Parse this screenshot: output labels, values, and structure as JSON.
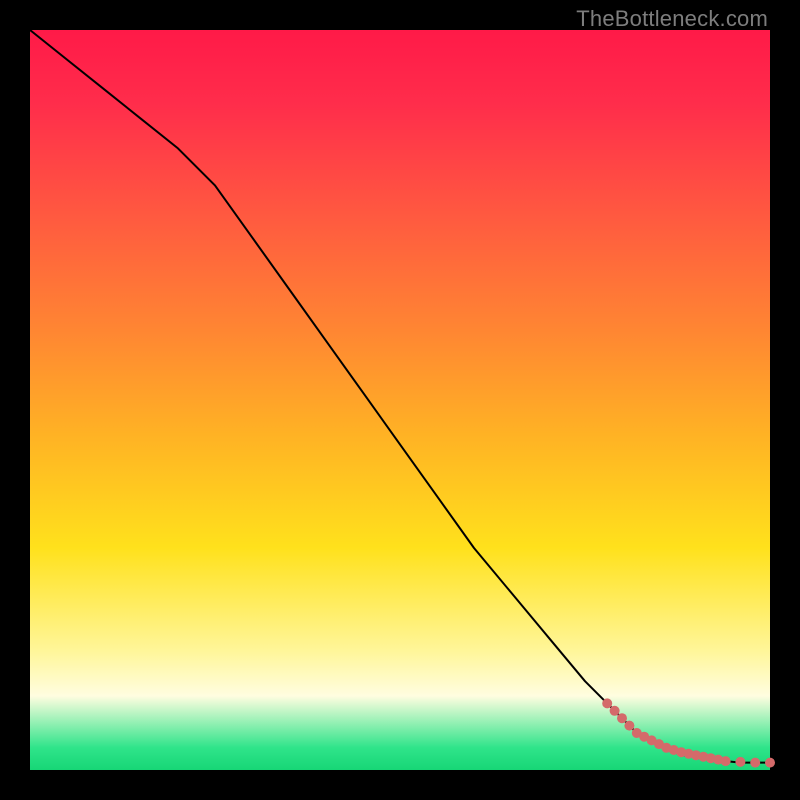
{
  "watermark": "TheBottleneck.com",
  "chart_data": {
    "type": "line",
    "title": "",
    "xlabel": "",
    "ylabel": "",
    "xlim": [
      0,
      100
    ],
    "ylim": [
      0,
      100
    ],
    "grid": false,
    "legend": false,
    "background_gradient": {
      "direction": "vertical",
      "stops": [
        {
          "pos": 0.0,
          "color": "#ff1a48"
        },
        {
          "pos": 0.25,
          "color": "#ff5940"
        },
        {
          "pos": 0.55,
          "color": "#ffb324"
        },
        {
          "pos": 0.8,
          "color": "#fff69a"
        },
        {
          "pos": 0.97,
          "color": "#2fe48a"
        },
        {
          "pos": 1.0,
          "color": "#17d676"
        }
      ]
    },
    "series": [
      {
        "name": "curve",
        "color": "#000000",
        "stroke_width": 2,
        "x": [
          0,
          5,
          10,
          15,
          20,
          25,
          30,
          35,
          40,
          45,
          50,
          55,
          60,
          65,
          70,
          75,
          80,
          82,
          84,
          86,
          88,
          90,
          92,
          94,
          96,
          98,
          100
        ],
        "y": [
          100,
          96,
          92,
          88,
          84,
          79,
          72,
          65,
          58,
          51,
          44,
          37,
          30,
          24,
          18,
          12,
          7,
          5,
          4,
          3,
          2,
          2,
          1.5,
          1.2,
          1.0,
          1.0,
          1.0
        ]
      },
      {
        "name": "points",
        "color": "#d46a6a",
        "marker": "circle",
        "marker_radius": 5,
        "x": [
          78,
          79,
          80,
          81,
          82,
          83,
          84,
          85,
          86,
          87,
          88,
          89,
          90,
          91,
          92,
          93,
          94,
          96,
          98,
          100
        ],
        "y": [
          9,
          8,
          7,
          6,
          5,
          4.5,
          4,
          3.5,
          3,
          2.7,
          2.4,
          2.2,
          2.0,
          1.8,
          1.6,
          1.4,
          1.2,
          1.1,
          1.0,
          1.0
        ]
      }
    ]
  }
}
